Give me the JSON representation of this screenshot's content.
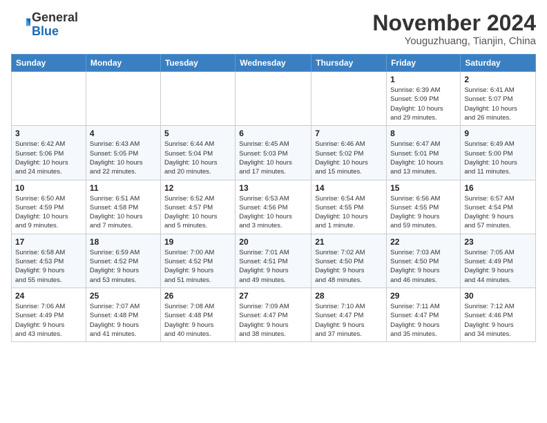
{
  "logo": {
    "general": "General",
    "blue": "Blue"
  },
  "header": {
    "month_year": "November 2024",
    "location": "Youguzhuang, Tianjin, China"
  },
  "days_of_week": [
    "Sunday",
    "Monday",
    "Tuesday",
    "Wednesday",
    "Thursday",
    "Friday",
    "Saturday"
  ],
  "weeks": [
    [
      {
        "day": "",
        "info": ""
      },
      {
        "day": "",
        "info": ""
      },
      {
        "day": "",
        "info": ""
      },
      {
        "day": "",
        "info": ""
      },
      {
        "day": "",
        "info": ""
      },
      {
        "day": "1",
        "info": "Sunrise: 6:39 AM\nSunset: 5:09 PM\nDaylight: 10 hours\nand 29 minutes."
      },
      {
        "day": "2",
        "info": "Sunrise: 6:41 AM\nSunset: 5:07 PM\nDaylight: 10 hours\nand 26 minutes."
      }
    ],
    [
      {
        "day": "3",
        "info": "Sunrise: 6:42 AM\nSunset: 5:06 PM\nDaylight: 10 hours\nand 24 minutes."
      },
      {
        "day": "4",
        "info": "Sunrise: 6:43 AM\nSunset: 5:05 PM\nDaylight: 10 hours\nand 22 minutes."
      },
      {
        "day": "5",
        "info": "Sunrise: 6:44 AM\nSunset: 5:04 PM\nDaylight: 10 hours\nand 20 minutes."
      },
      {
        "day": "6",
        "info": "Sunrise: 6:45 AM\nSunset: 5:03 PM\nDaylight: 10 hours\nand 17 minutes."
      },
      {
        "day": "7",
        "info": "Sunrise: 6:46 AM\nSunset: 5:02 PM\nDaylight: 10 hours\nand 15 minutes."
      },
      {
        "day": "8",
        "info": "Sunrise: 6:47 AM\nSunset: 5:01 PM\nDaylight: 10 hours\nand 13 minutes."
      },
      {
        "day": "9",
        "info": "Sunrise: 6:49 AM\nSunset: 5:00 PM\nDaylight: 10 hours\nand 11 minutes."
      }
    ],
    [
      {
        "day": "10",
        "info": "Sunrise: 6:50 AM\nSunset: 4:59 PM\nDaylight: 10 hours\nand 9 minutes."
      },
      {
        "day": "11",
        "info": "Sunrise: 6:51 AM\nSunset: 4:58 PM\nDaylight: 10 hours\nand 7 minutes."
      },
      {
        "day": "12",
        "info": "Sunrise: 6:52 AM\nSunset: 4:57 PM\nDaylight: 10 hours\nand 5 minutes."
      },
      {
        "day": "13",
        "info": "Sunrise: 6:53 AM\nSunset: 4:56 PM\nDaylight: 10 hours\nand 3 minutes."
      },
      {
        "day": "14",
        "info": "Sunrise: 6:54 AM\nSunset: 4:55 PM\nDaylight: 10 hours\nand 1 minute."
      },
      {
        "day": "15",
        "info": "Sunrise: 6:56 AM\nSunset: 4:55 PM\nDaylight: 9 hours\nand 59 minutes."
      },
      {
        "day": "16",
        "info": "Sunrise: 6:57 AM\nSunset: 4:54 PM\nDaylight: 9 hours\nand 57 minutes."
      }
    ],
    [
      {
        "day": "17",
        "info": "Sunrise: 6:58 AM\nSunset: 4:53 PM\nDaylight: 9 hours\nand 55 minutes."
      },
      {
        "day": "18",
        "info": "Sunrise: 6:59 AM\nSunset: 4:52 PM\nDaylight: 9 hours\nand 53 minutes."
      },
      {
        "day": "19",
        "info": "Sunrise: 7:00 AM\nSunset: 4:52 PM\nDaylight: 9 hours\nand 51 minutes."
      },
      {
        "day": "20",
        "info": "Sunrise: 7:01 AM\nSunset: 4:51 PM\nDaylight: 9 hours\nand 49 minutes."
      },
      {
        "day": "21",
        "info": "Sunrise: 7:02 AM\nSunset: 4:50 PM\nDaylight: 9 hours\nand 48 minutes."
      },
      {
        "day": "22",
        "info": "Sunrise: 7:03 AM\nSunset: 4:50 PM\nDaylight: 9 hours\nand 46 minutes."
      },
      {
        "day": "23",
        "info": "Sunrise: 7:05 AM\nSunset: 4:49 PM\nDaylight: 9 hours\nand 44 minutes."
      }
    ],
    [
      {
        "day": "24",
        "info": "Sunrise: 7:06 AM\nSunset: 4:49 PM\nDaylight: 9 hours\nand 43 minutes."
      },
      {
        "day": "25",
        "info": "Sunrise: 7:07 AM\nSunset: 4:48 PM\nDaylight: 9 hours\nand 41 minutes."
      },
      {
        "day": "26",
        "info": "Sunrise: 7:08 AM\nSunset: 4:48 PM\nDaylight: 9 hours\nand 40 minutes."
      },
      {
        "day": "27",
        "info": "Sunrise: 7:09 AM\nSunset: 4:47 PM\nDaylight: 9 hours\nand 38 minutes."
      },
      {
        "day": "28",
        "info": "Sunrise: 7:10 AM\nSunset: 4:47 PM\nDaylight: 9 hours\nand 37 minutes."
      },
      {
        "day": "29",
        "info": "Sunrise: 7:11 AM\nSunset: 4:47 PM\nDaylight: 9 hours\nand 35 minutes."
      },
      {
        "day": "30",
        "info": "Sunrise: 7:12 AM\nSunset: 4:46 PM\nDaylight: 9 hours\nand 34 minutes."
      }
    ]
  ]
}
